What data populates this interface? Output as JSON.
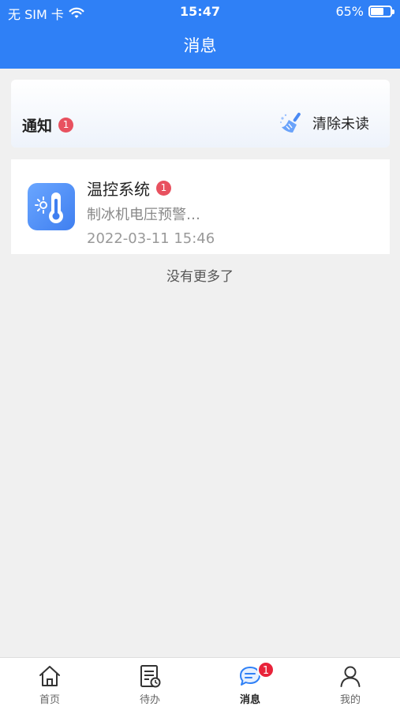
{
  "status_bar": {
    "carrier": "无 SIM 卡",
    "time": "15:47",
    "battery": "65%",
    "battery_level": 0.65
  },
  "nav": {
    "title": "消息"
  },
  "notice": {
    "title": "通知",
    "badge": "1",
    "clear_label": "清除未读"
  },
  "messages": [
    {
      "title": "温控系统",
      "badge": "1",
      "preview": "制冰机电压预警…",
      "time": "2022-03-11 15:46",
      "icon": "thermometer-icon"
    }
  ],
  "no_more_text": "没有更多了",
  "tabs": [
    {
      "label": "首页",
      "icon": "home-icon"
    },
    {
      "label": "待办",
      "icon": "todo-list-icon"
    },
    {
      "label": "消息",
      "icon": "message-icon",
      "badge": "1",
      "active": true
    },
    {
      "label": "我的",
      "icon": "user-icon"
    }
  ],
  "colors": {
    "primary": "#2f80f6",
    "badge": "#e8515f",
    "background": "#f0f0f0"
  }
}
